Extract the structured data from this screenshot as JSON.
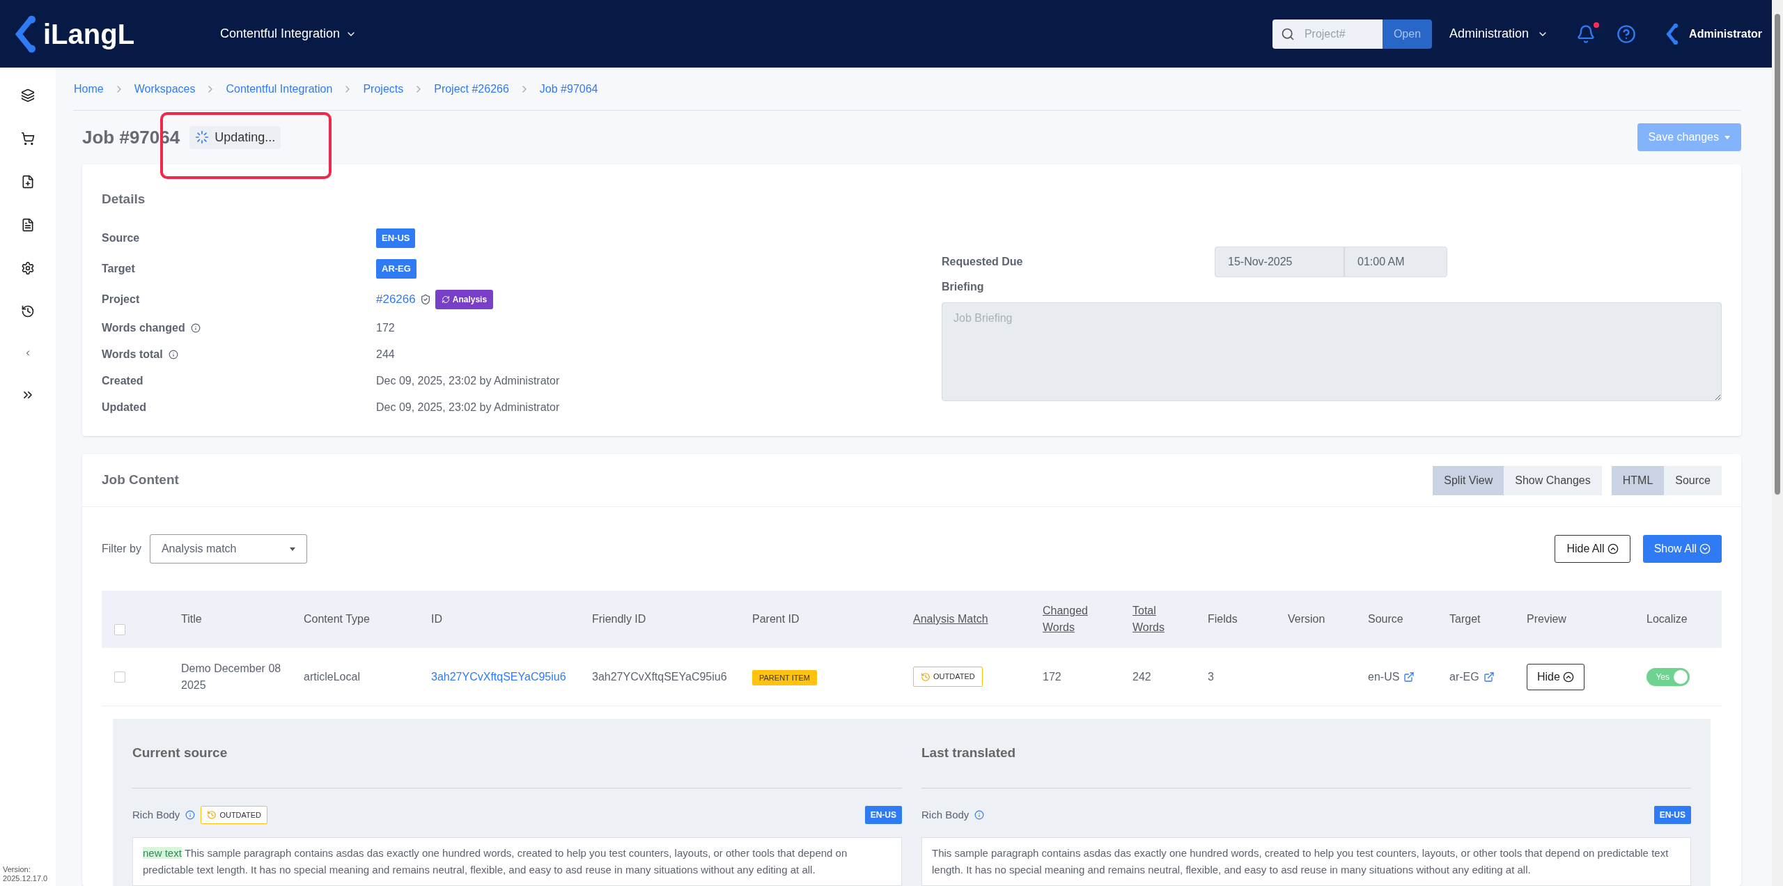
{
  "header": {
    "brand": "iLangL",
    "workspace": "Contentful Integration",
    "search": {
      "placeholder": "Project#",
      "button": "Open"
    },
    "admin_menu": "Administration",
    "notifications": {
      "unread": true
    },
    "user": "Administrator"
  },
  "sidebar": {
    "items": [
      {
        "kind": "layers"
      },
      {
        "kind": "cart"
      },
      {
        "kind": "file-plus"
      },
      {
        "kind": "report"
      },
      {
        "kind": "settings"
      },
      {
        "kind": "history"
      },
      {
        "kind": "collapse"
      },
      {
        "kind": "expand"
      }
    ],
    "version": "Version: 2025.12.17.0"
  },
  "breadcrumbs": [
    "Home",
    "Workspaces",
    "Contentful Integration",
    "Projects",
    "Project #26266",
    "Job #97064"
  ],
  "page": {
    "title": "Job #97064",
    "status": "Updating...",
    "save_button": "Save changes"
  },
  "details": {
    "title": "Details",
    "rows": [
      {
        "label": "Source",
        "kind": "badge",
        "value": "EN-US",
        "info": false
      },
      {
        "label": "Target",
        "kind": "badge",
        "value": "AR-EG",
        "info": false
      },
      {
        "label": "Project",
        "kind": "project",
        "value": "#26266",
        "tag": "Analysis",
        "info": false
      },
      {
        "label": "Words changed",
        "kind": "text",
        "value": "172",
        "info": true
      },
      {
        "label": "Words total",
        "kind": "text",
        "value": "244",
        "info": true
      },
      {
        "label": "Created",
        "kind": "text",
        "value": "Dec 09, 2025, 23:02 by Administrator",
        "info": false
      },
      {
        "label": "Updated",
        "kind": "text",
        "value": "Dec 09, 2025, 23:02 by Administrator",
        "info": false
      }
    ],
    "requested_due": {
      "label": "Requested Due",
      "date": "15-Nov-2025",
      "time": "01:00 AM"
    },
    "briefing": {
      "label": "Briefing",
      "placeholder": "Job Briefing"
    }
  },
  "job_content": {
    "title": "Job Content",
    "view_toggle": [
      {
        "label": "Split View",
        "selected": true
      },
      {
        "label": "Show Changes",
        "selected": false
      }
    ],
    "format_toggle": [
      {
        "label": "HTML",
        "selected": true
      },
      {
        "label": "Source",
        "selected": false
      }
    ],
    "filter": {
      "label": "Filter by",
      "value": "Analysis match"
    },
    "hide_all": "Hide All",
    "show_all": "Show All",
    "table": {
      "select_all": {
        "checked": false
      },
      "columns": [
        {
          "label": "Title",
          "sortable": false
        },
        {
          "label": "Content Type",
          "sortable": false
        },
        {
          "label": "ID",
          "sortable": false
        },
        {
          "label": "Friendly ID",
          "sortable": false
        },
        {
          "label": "Parent ID",
          "sortable": false
        },
        {
          "label": "Analysis Match",
          "sortable": true
        },
        {
          "label": "Changed Words",
          "sortable": true
        },
        {
          "label": "Total Words",
          "sortable": true
        },
        {
          "label": "Fields",
          "sortable": false
        },
        {
          "label": "Version",
          "sortable": false
        },
        {
          "label": "Source",
          "sortable": false
        },
        {
          "label": "Target",
          "sortable": false
        },
        {
          "label": "Preview",
          "sortable": false
        },
        {
          "label": "Localize",
          "sortable": false
        }
      ],
      "rows": [
        {
          "checked": false,
          "title": "Demo December 08 2025",
          "content_type": "articleLocal",
          "id": "3ah27YCvXftqSEYaC95iu6",
          "friendly_id": "3ah27YCvXftqSEYaC95iu6",
          "parent": "PARENT ITEM",
          "analysis": "OUTDATED",
          "changed": "172",
          "total": "242",
          "fields": "3",
          "source": "en-US",
          "target": "ar-EG",
          "preview": "Hide",
          "localize": {
            "on": true,
            "label": "Yes"
          }
        }
      ]
    },
    "preview": {
      "columns": [
        {
          "title": "Current source",
          "field": "Rich Body",
          "badge": "OUTDATED",
          "lang": "EN-US",
          "inserted": "new text",
          "text": "This sample paragraph contains asdas das exactly one hundred words, created to help you test counters, layouts, or other tools that depend on predictable text length. It has no special meaning and remains neutral, flexible, and easy to asd reuse in many situations without any editing at all."
        },
        {
          "title": "Last translated",
          "field": "Rich Body",
          "lang": "EN-US",
          "text": "This sample paragraph contains asdas das exactly one hundred words, created to help you test counters, layouts, or other tools that depend on predictable text length. It has no special meaning and remains neutral, flexible, and easy to asd reuse in many situations without any editing at all."
        }
      ]
    }
  }
}
